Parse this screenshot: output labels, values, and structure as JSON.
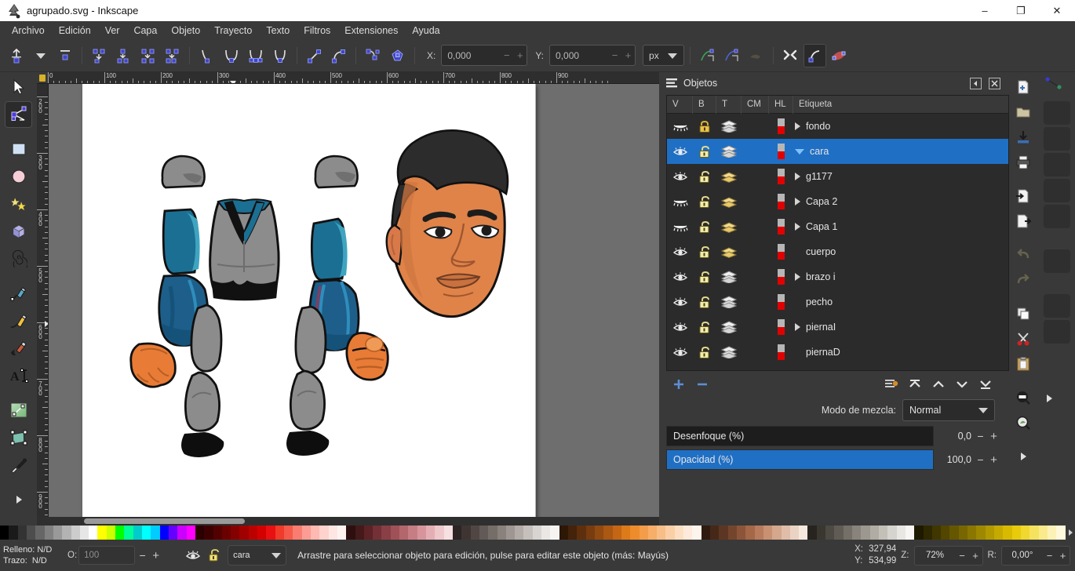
{
  "window": {
    "title": "agrupado.svg - Inkscape",
    "app_icon": "inkscape-logo-icon",
    "minimize": "–",
    "maximize": "❐",
    "close": "✕"
  },
  "menubar": {
    "items": [
      {
        "label": "Archivo"
      },
      {
        "label": "Edición"
      },
      {
        "label": "Ver"
      },
      {
        "label": "Capa"
      },
      {
        "label": "Objeto"
      },
      {
        "label": "Trayecto"
      },
      {
        "label": "Texto"
      },
      {
        "label": "Filtros"
      },
      {
        "label": "Extensiones"
      },
      {
        "label": "Ayuda"
      }
    ]
  },
  "tool_controls": {
    "x_label": "X:",
    "x_value": "0,000",
    "y_label": "Y:",
    "y_value": "0,000",
    "unit": "px",
    "minus": "−",
    "plus": "+",
    "buttons": [
      {
        "name": "insert-node-button"
      },
      {
        "name": "insert-node-dropdown-button"
      },
      {
        "name": "delete-node-button"
      },
      {
        "name": "break-path-button"
      },
      {
        "name": "join-nodes-button"
      },
      {
        "name": "join-with-segment-button"
      },
      {
        "name": "delete-segment-button"
      },
      {
        "name": "node-corner-button"
      },
      {
        "name": "node-smooth-button"
      },
      {
        "name": "node-symmetric-button"
      },
      {
        "name": "node-auto-button"
      },
      {
        "name": "segment-line-button"
      },
      {
        "name": "segment-curve-button"
      },
      {
        "name": "object-to-path-button"
      },
      {
        "name": "stroke-to-path-button"
      },
      {
        "name": "show-transform-handles-button"
      },
      {
        "name": "show-bezier-handles-button"
      },
      {
        "name": "show-outline-button"
      },
      {
        "name": "next-path-effect-button"
      },
      {
        "name": "mask-edit-button"
      },
      {
        "name": "clip-edit-button"
      }
    ]
  },
  "toolbox": {
    "tools": [
      {
        "name": "selector-tool",
        "active": false
      },
      {
        "name": "node-tool",
        "active": true
      },
      {
        "name": "rectangle-tool",
        "active": false
      },
      {
        "name": "ellipse-tool",
        "active": false
      },
      {
        "name": "star-tool",
        "active": false
      },
      {
        "name": "box3d-tool",
        "active": false
      },
      {
        "name": "spiral-tool",
        "active": false
      },
      {
        "name": "pencil-tool",
        "active": false
      },
      {
        "name": "bezier-tool",
        "active": false
      },
      {
        "name": "calligraphy-tool",
        "active": false
      },
      {
        "name": "text-tool",
        "active": false
      },
      {
        "name": "gradient-tool",
        "active": false
      },
      {
        "name": "tweak-tool",
        "active": false
      },
      {
        "name": "dropper-tool",
        "active": false
      },
      {
        "name": "more-tools-arrow",
        "active": false
      }
    ]
  },
  "rulers": {
    "horizontal_ticks": [
      "0",
      "100",
      "200",
      "300",
      "400",
      "500",
      "600",
      "700",
      "800",
      "900"
    ],
    "vertical_ticks": [
      "200",
      "300",
      "400",
      "500",
      "600",
      "700",
      "800",
      "900"
    ],
    "unit": "px"
  },
  "objects_panel": {
    "title": "Objetos",
    "icon": "objects-panel-icon",
    "collapse_button": "◀",
    "close_button": "✕",
    "columns": [
      "V",
      "B",
      "T",
      "CM",
      "HL",
      "Etiqueta"
    ],
    "rows": [
      {
        "label": "fondo",
        "indent": 0,
        "expander": "collapsed",
        "selected": false,
        "visible": false,
        "locked": true,
        "type": "layer"
      },
      {
        "label": "cara",
        "indent": 0,
        "expander": "expanded",
        "selected": true,
        "visible": true,
        "locked": false,
        "type": "layer"
      },
      {
        "label": "g1177",
        "indent": 1,
        "expander": "collapsed",
        "selected": false,
        "visible": true,
        "locked": false,
        "type": "group"
      },
      {
        "label": "Capa 2",
        "indent": 1,
        "expander": "collapsed",
        "selected": false,
        "visible": false,
        "locked": false,
        "type": "group"
      },
      {
        "label": "Capa 1",
        "indent": 1,
        "expander": "collapsed",
        "selected": false,
        "visible": false,
        "locked": false,
        "type": "group"
      },
      {
        "label": "cuerpo",
        "indent": 1,
        "expander": "none",
        "selected": false,
        "visible": true,
        "locked": false,
        "type": "group"
      },
      {
        "label": "brazo i",
        "indent": 0,
        "expander": "collapsed",
        "selected": false,
        "visible": true,
        "locked": false,
        "type": "layer"
      },
      {
        "label": "pecho",
        "indent": 0,
        "expander": "none",
        "selected": false,
        "visible": true,
        "locked": false,
        "type": "layer"
      },
      {
        "label": "piernaI",
        "indent": 0,
        "expander": "collapsed",
        "selected": false,
        "visible": true,
        "locked": false,
        "type": "layer"
      },
      {
        "label": "piernaD",
        "indent": 0,
        "expander": "none",
        "selected": false,
        "visible": true,
        "locked": false,
        "type": "layer"
      }
    ],
    "toolbar": {
      "add": "+",
      "remove": "−",
      "buttons": [
        {
          "name": "add-object-button"
        },
        {
          "name": "remove-object-button"
        },
        {
          "name": "layer-properties-button"
        },
        {
          "name": "raise-to-top-button"
        },
        {
          "name": "raise-button"
        },
        {
          "name": "lower-button"
        },
        {
          "name": "lower-to-bottom-button"
        }
      ]
    },
    "blend_mode_label": "Modo de mezcla:",
    "blend_mode_value": "Normal",
    "blur_label": "Desenfoque (%)",
    "blur_value": "0,0",
    "opacity_label": "Opacidad (%)",
    "opacity_value": "100,0",
    "minus": "−",
    "plus": "+"
  },
  "command_bar": {
    "buttons": [
      {
        "name": "new-document-icon"
      },
      {
        "name": "open-document-icon"
      },
      {
        "name": "save-document-icon"
      },
      {
        "name": "print-document-icon"
      },
      {
        "name": "import-icon"
      },
      {
        "name": "export-icon"
      },
      {
        "name": "undo-icon"
      },
      {
        "name": "redo-icon"
      },
      {
        "name": "duplicate-icon"
      },
      {
        "name": "cut-scissors-icon"
      },
      {
        "name": "paste-clipboard-icon"
      },
      {
        "name": "zoom-page-icon"
      },
      {
        "name": "zoom-drawing-icon"
      },
      {
        "name": "more-commands-arrow-icon"
      }
    ]
  },
  "snap_bar": {
    "buttons": [
      {
        "name": "snap-enable-toggle"
      },
      {
        "name": "snap-bounding-box-toggle"
      },
      {
        "name": "snap-bbox-edge-toggle"
      },
      {
        "name": "snap-bbox-corner-toggle"
      },
      {
        "name": "snap-nodes-toggle"
      },
      {
        "name": "snap-paths-toggle"
      },
      {
        "name": "snap-cusp-nodes-toggle"
      },
      {
        "name": "snap-others-toggle"
      },
      {
        "name": "snap-grid-toggle"
      },
      {
        "name": "more-snap-arrow-icon"
      }
    ]
  },
  "status_bar": {
    "fill_label": "Relleno:",
    "fill_value": "N/D",
    "stroke_label": "Trazo:",
    "stroke_value": "N/D",
    "opacity_label": "O:",
    "opacity_value": "100",
    "minus": "−",
    "plus": "+",
    "layer_visibility_icon": "eye-icon",
    "layer_lock_icon": "unlocked-padlock-icon",
    "current_layer": "cara",
    "message": "Arrastre para seleccionar objeto para edición, pulse para editar este objeto (más: Mayús)",
    "x_label": "X:",
    "x_value": "327,94",
    "y_label": "Y:",
    "y_value": "534,99",
    "zoom_label": "Z:",
    "zoom_value": "72%",
    "rotation_label": "R:",
    "rotation_value": "0,00°"
  },
  "palette": {
    "colors": [
      "#000000",
      "#1a1a1a",
      "#333333",
      "#4d4d4d",
      "#666666",
      "#808080",
      "#999999",
      "#b3b3b3",
      "#cccccc",
      "#e6e6e6",
      "#ffffff",
      "#ffff00",
      "#ccff00",
      "#00ff00",
      "#00ff99",
      "#00cccc",
      "#00ffff",
      "#00ccff",
      "#0000ff",
      "#6600ff",
      "#cc00ff",
      "#ff00ff",
      "#2b0000",
      "#3d0000",
      "#520000",
      "#6b0000",
      "#850000",
      "#a00000",
      "#bb0000",
      "#d40000",
      "#e81010",
      "#f03a2a",
      "#f4594a",
      "#f87c70",
      "#fb9d94",
      "#fdb9b2",
      "#fed2cd",
      "#ffe6e3",
      "#fff3f1",
      "#2e0f0f",
      "#44191a",
      "#5c2326",
      "#733036",
      "#8a3f46",
      "#a05158",
      "#b4666d",
      "#c67d84",
      "#d7959b",
      "#e4afb4",
      "#eec8cb",
      "#f7e0e2",
      "#2c2523",
      "#3e3533",
      "#504744",
      "#625a56",
      "#756d68",
      "#8a817c",
      "#9e9692",
      "#b2aba7",
      "#c5c0bc",
      "#d8d4d1",
      "#eae7e5",
      "#f6f4f3",
      "#2d1705",
      "#45220a",
      "#5e2f0d",
      "#783c0f",
      "#914a10",
      "#aa5812",
      "#c46614",
      "#dd7a19",
      "#ee8c2c",
      "#f39d4a",
      "#f6ae68",
      "#f8be87",
      "#facfa5",
      "#fcdfc3",
      "#fdeadb",
      "#fef4ee",
      "#2f1b10",
      "#462819",
      "#5d3623",
      "#74452d",
      "#8c5539",
      "#a46747",
      "#b87b5c",
      "#c89172",
      "#d5a78c",
      "#e0bda8",
      "#ebd3c4",
      "#f5e8df",
      "#272420",
      "#3a3731",
      "#4d4943",
      "#605c55",
      "#747068",
      "#88847b",
      "#9c988f",
      "#b0aca3",
      "#c3c0b8",
      "#d6d4ce",
      "#e9e7e3",
      "#f7f6f4",
      "#1e1a00",
      "#2e2800",
      "#403700",
      "#524600",
      "#655600",
      "#786600",
      "#8b7700",
      "#9e8800",
      "#b29900",
      "#c5aa00",
      "#d8bb00",
      "#e8cb0a",
      "#f0d830",
      "#f5e25e",
      "#f9ea8c",
      "#fcf2b8",
      "#fef8dc"
    ]
  },
  "canvas": {
    "artwork_description": "character-body-parts-illustration",
    "page_background": "#ffffff",
    "canvas_background": "#6e6e6e",
    "colors": {
      "grey": "#8a8a8a",
      "grey_dark": "#6f6f6f",
      "blue": "#1b6f93",
      "blue_light": "#2f92b5",
      "blue_dark": "#1d5f8a",
      "blue_deep": "#15527a",
      "orange": "#e87b36",
      "skin": "#e08349",
      "skin_shadow": "#c96f3c",
      "hair": "#2c2c2c",
      "black": "#111111"
    }
  }
}
